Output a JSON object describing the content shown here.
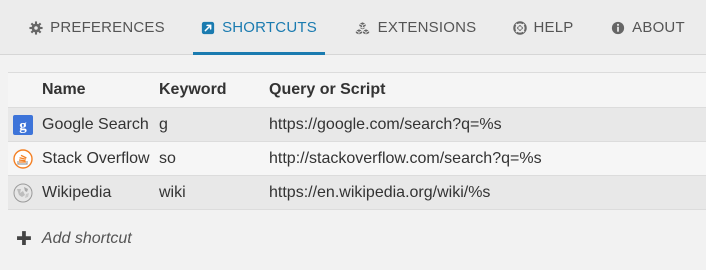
{
  "tabs": [
    {
      "label": "PREFERENCES",
      "icon": "gear-icon"
    },
    {
      "label": "SHORTCUTS",
      "icon": "shortcut-icon",
      "active": true
    },
    {
      "label": "EXTENSIONS",
      "icon": "cubes-icon"
    },
    {
      "label": "HELP",
      "icon": "lifebuoy-icon"
    },
    {
      "label": "ABOUT",
      "icon": "info-icon"
    }
  ],
  "table": {
    "headers": {
      "name": "Name",
      "keyword": "Keyword",
      "query": "Query or Script"
    },
    "rows": [
      {
        "icon": "google-icon",
        "name": "Google Search",
        "keyword": "g",
        "query": "https://google.com/search?q=%s"
      },
      {
        "icon": "stackoverflow-icon",
        "name": "Stack Overflow",
        "keyword": "so",
        "query": "http://stackoverflow.com/search?q=%s"
      },
      {
        "icon": "wikipedia-icon",
        "name": "Wikipedia",
        "keyword": "wiki",
        "query": "https://en.wikipedia.org/wiki/%s"
      }
    ]
  },
  "add_shortcut": {
    "label": "Add shortcut"
  },
  "colors": {
    "accent": "#1a7bb0",
    "background": "#f2f2f2"
  }
}
